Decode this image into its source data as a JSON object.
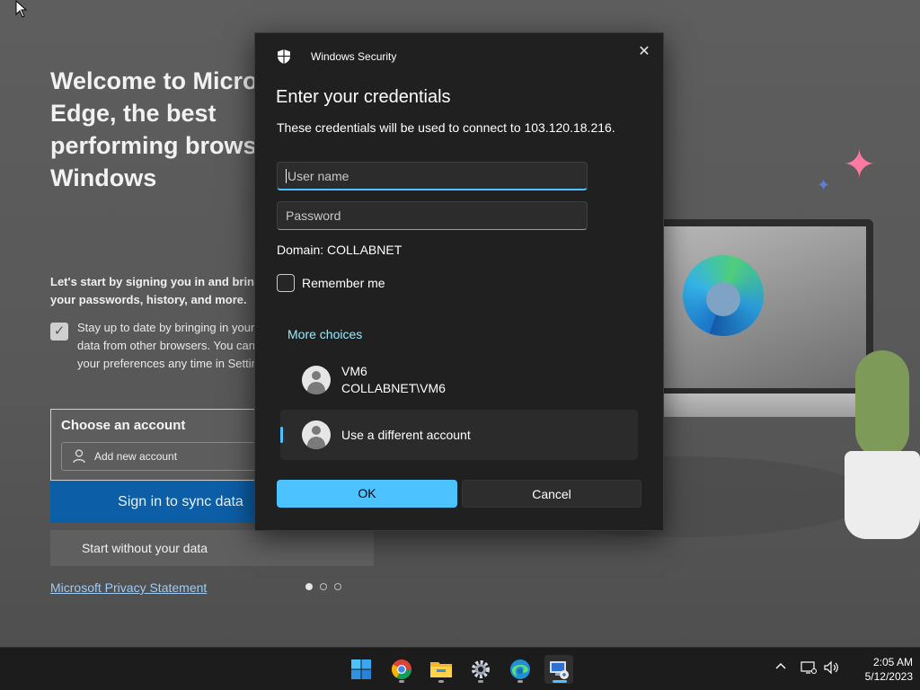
{
  "background": {
    "welcome_title": "Welcome to Microsoft Edge, the best performing browser on Windows",
    "intro": "Let's start by signing you in and bringing over your passwords, history, and more.",
    "stay_up_to_date": "Stay up to date by bringing in your browsing data from other browsers. You can manage your preferences any time in Settings.",
    "choose_account": "Choose an account",
    "add_new_account": "Add new account",
    "sign_in_sync": "Sign in to sync data",
    "start_without": "Start without your data",
    "privacy": "Microsoft Privacy Statement"
  },
  "dialog": {
    "app_title": "Windows Security",
    "heading": "Enter your credentials",
    "description": "These credentials will be used to connect to 103.120.18.216.",
    "username_placeholder": "User name",
    "password_placeholder": "Password",
    "domain": "Domain: COLLABNET",
    "remember_me": "Remember me",
    "more_choices": "More choices",
    "accounts": [
      {
        "name": "VM6",
        "detail": "COLLABNET\\VM6"
      },
      {
        "name": "Use a different account"
      }
    ],
    "ok_label": "OK",
    "cancel_label": "Cancel",
    "close_icon": "close-icon",
    "shield_icon": "shield-icon"
  },
  "taskbar": {
    "apps": [
      "start-icon",
      "chrome-icon",
      "file-explorer-icon",
      "settings-icon",
      "edge-icon",
      "remote-desktop-icon"
    ],
    "time": "2:05 AM",
    "date": "5/12/2023"
  },
  "colors": {
    "accent": "#4cc2ff",
    "dialog_bg": "#202020",
    "link": "#99ebff"
  }
}
